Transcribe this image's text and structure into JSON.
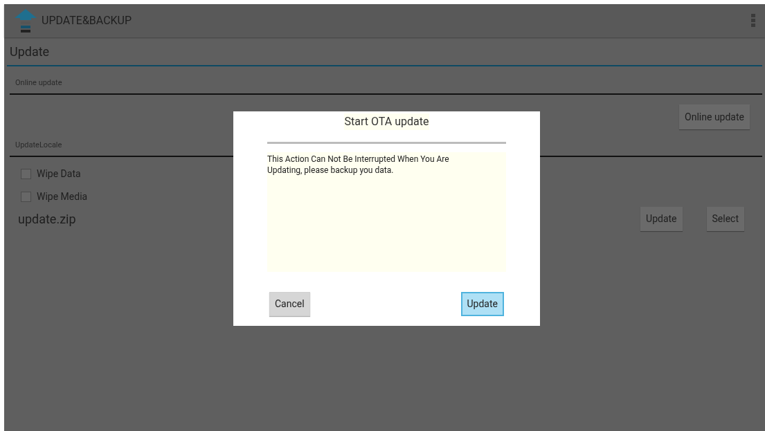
{
  "action_bar": {
    "title": "UPDATE&BACKUP"
  },
  "page": {
    "title": "Update",
    "online_section": {
      "header": "Online update",
      "button": "Online update"
    },
    "local_section": {
      "header": "UpdateLocale",
      "options": [
        {
          "label": "Wipe Data",
          "checked": false
        },
        {
          "label": "Wipe Media",
          "checked": false
        }
      ],
      "file": "update.zip",
      "buttons": [
        "Update",
        "Select"
      ]
    }
  },
  "dialog": {
    "title": "Start OTA update",
    "message": "This Action Can Not Be Interrupted When You Are Updating, please backup you data.",
    "buttons": [
      {
        "label": "Cancel",
        "focused": false
      },
      {
        "label": "Update",
        "focused": true
      }
    ]
  }
}
